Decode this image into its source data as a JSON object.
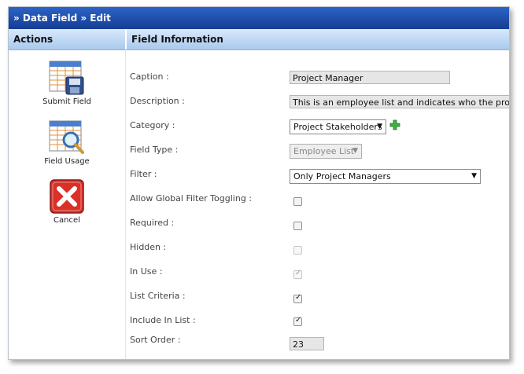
{
  "title": "» Data Field » Edit",
  "headers": {
    "actions": "Actions",
    "info": "Field Information"
  },
  "actions": [
    {
      "label": "Submit Field",
      "icon": "submit-field-icon"
    },
    {
      "label": "Field Usage",
      "icon": "field-usage-icon"
    },
    {
      "label": "Cancel",
      "icon": "cancel-icon"
    }
  ],
  "fields": {
    "caption": {
      "label": "Caption :",
      "value": "Project Manager"
    },
    "description": {
      "label": "Description :",
      "value": "This is an employee list and indicates who the project manager is"
    },
    "category": {
      "label": "Category :",
      "value": "Project Stakeholders"
    },
    "field_type": {
      "label": "Field Type :",
      "value": "Employee List"
    },
    "filter": {
      "label": "Filter :",
      "value": "Only Project Managers"
    },
    "allow_global": {
      "label": "Allow Global Filter Toggling :",
      "checked": false,
      "disabled": false
    },
    "required": {
      "label": "Required :",
      "checked": false,
      "disabled": false
    },
    "hidden": {
      "label": "Hidden :",
      "checked": false,
      "disabled": true
    },
    "in_use": {
      "label": "In Use :",
      "checked": true,
      "disabled": true
    },
    "list_criteria": {
      "label": "List Criteria :",
      "checked": true,
      "disabled": false
    },
    "include_in_list": {
      "label": "Include In List :",
      "checked": true,
      "disabled": false
    },
    "sort_order": {
      "label": "Sort Order :",
      "value": "23"
    }
  },
  "colors": {
    "titlebar": "#1f4fae",
    "header": "#bcd6f3",
    "add": "#3cb043",
    "cancel": "#d9302a"
  }
}
